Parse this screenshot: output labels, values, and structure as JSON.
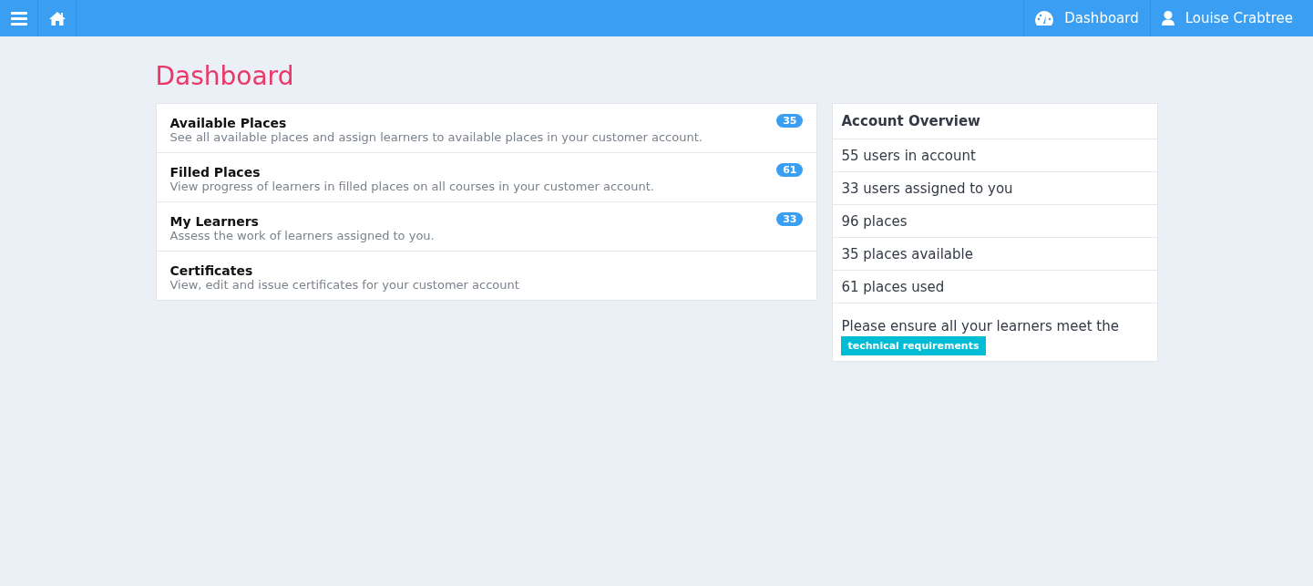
{
  "navbar": {
    "nav_links": [
      {
        "kind": "dashboard",
        "label": "Dashboard"
      },
      {
        "kind": "user",
        "label": "Louise Crabtree"
      }
    ]
  },
  "page_title": "Dashboard",
  "menu_items": [
    {
      "title": "Available Places",
      "description": "See all available places and assign learners to available places in your customer account.",
      "badge": "35"
    },
    {
      "title": "Filled Places",
      "description": "View progress of learners in filled places on all courses in your customer account.",
      "badge": "61"
    },
    {
      "title": "My Learners",
      "description": "Assess the work of learners assigned to you.",
      "badge": "33"
    },
    {
      "title": "Certificates",
      "description": "View, edit and issue certificates for your customer account"
    }
  ],
  "account_overview": {
    "title": "Account Overview",
    "stats": [
      "55 users in account",
      "33 users assigned to you",
      "96 places",
      "35 places available",
      "61 places used"
    ],
    "notice": "Please ensure all your learners meet the",
    "notice_link": "technical requirements"
  }
}
